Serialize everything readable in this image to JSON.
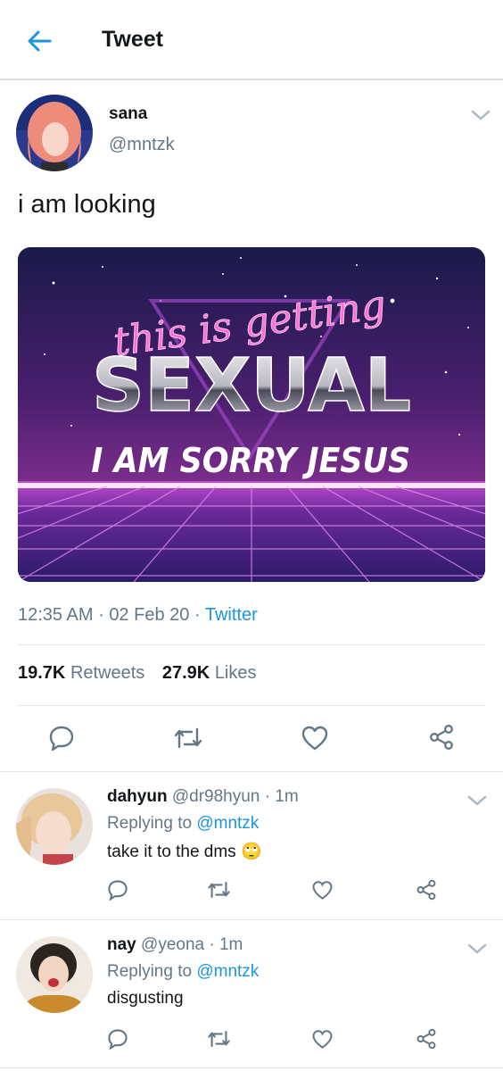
{
  "header": {
    "title": "Tweet"
  },
  "tweet": {
    "author_name": "sana",
    "author_handle": "@mntzk",
    "text": "i am looking",
    "image": {
      "line1": "this is getting",
      "line2": "SEXUAL",
      "line3": "I AM SORRY JESUS"
    },
    "time": "12:35 AM",
    "date": "02 Feb 20",
    "source": "Twitter",
    "retweets_count": "19.7K",
    "retweets_label": "Retweets",
    "likes_count": "27.9K",
    "likes_label": "Likes"
  },
  "replies": [
    {
      "name": "dahyun",
      "handle": "@dr98hyun",
      "time": "1m",
      "replying_label": "Replying to",
      "replying_to": "@mntzk",
      "text": "take it to the dms",
      "emoji": "🙄"
    },
    {
      "name": "nay",
      "handle": "@yeona",
      "time": "1m",
      "replying_label": "Replying to",
      "replying_to": "@mntzk",
      "text": "disgusting"
    }
  ],
  "separator": "·",
  "colors": {
    "accent": "#1b95e0",
    "text": "#14171a",
    "secondary": "#657786"
  }
}
